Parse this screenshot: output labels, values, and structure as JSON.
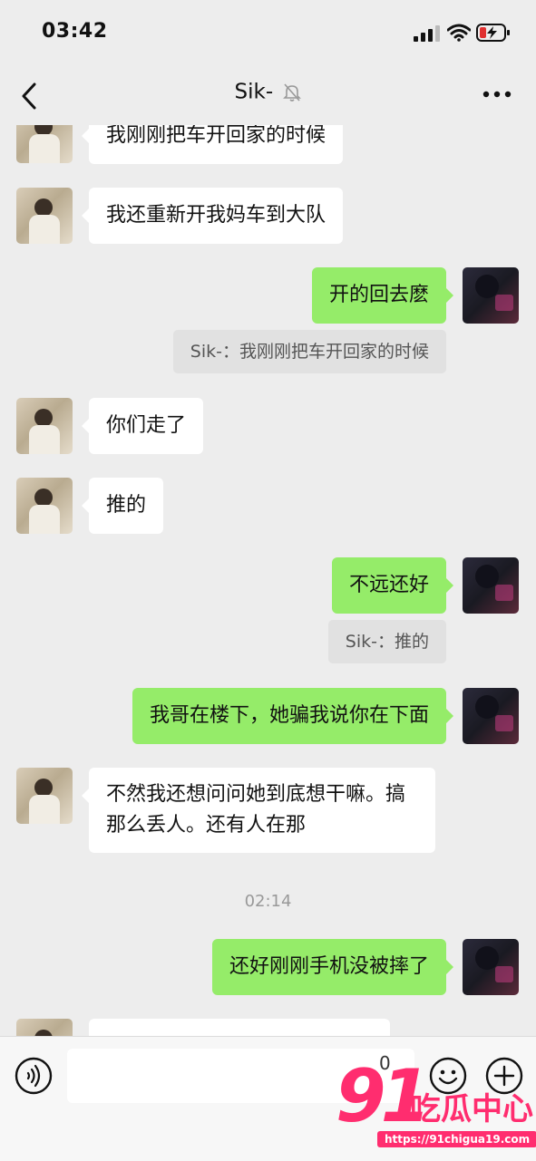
{
  "status_bar": {
    "time": "03:42"
  },
  "header": {
    "title": "Sik-"
  },
  "messages": [
    {
      "side": "left",
      "text": "我刚刚把车开回家的时候"
    },
    {
      "side": "left",
      "text": "我还重新开我妈车到大队"
    },
    {
      "side": "right",
      "text": "开的回去麽",
      "quote": "Sik-：我刚刚把车开回家的时候"
    },
    {
      "side": "left",
      "text": "你们走了"
    },
    {
      "side": "left",
      "text": "推的"
    },
    {
      "side": "right",
      "text": "不远还好",
      "quote": "Sik-：推的"
    },
    {
      "side": "right",
      "text": "我哥在楼下，她骗我说你在下面"
    },
    {
      "side": "left",
      "text": "不然我还想问问她到底想干嘛。搞那么丢人。还有人在那"
    },
    {
      "side": "timestamp",
      "text": "02:14"
    },
    {
      "side": "right",
      "text": "还好刚刚手机没被摔了"
    }
  ],
  "input": {
    "value": "0"
  },
  "watermark": {
    "logo": "91",
    "name": "吃瓜中心",
    "url": "https://91chigua19.com"
  },
  "colors": {
    "bubble_self": "#95ec69",
    "bubble_other": "#ffffff",
    "background": "#ededed"
  }
}
